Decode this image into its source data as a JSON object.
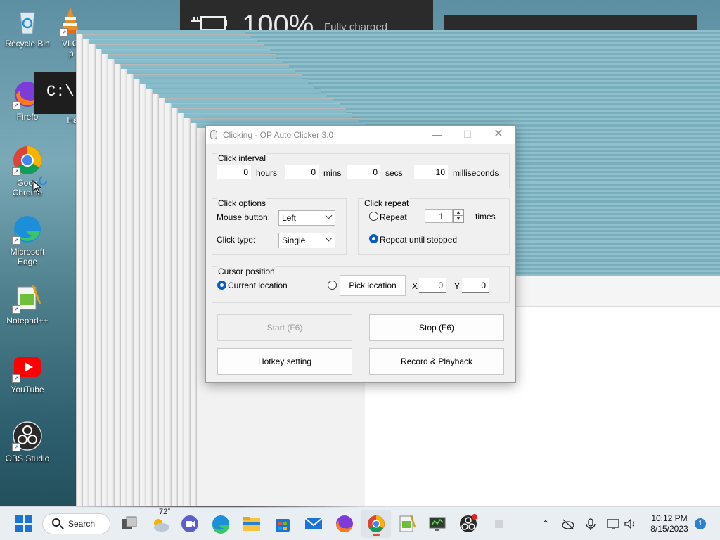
{
  "desktop": {
    "icons": [
      {
        "label": "Recycle Bin"
      },
      {
        "label": "VLC"
      },
      {
        "label": "p"
      },
      {
        "label": "Firefo"
      },
      {
        "label": "Ha"
      },
      {
        "label": "Goog Chrome"
      },
      {
        "label": "Microsoft Edge"
      },
      {
        "label": "Notepad++"
      },
      {
        "label": "YouTube"
      },
      {
        "label": "OBS Studio"
      }
    ]
  },
  "battery": {
    "percent": "100%",
    "status": "Fully charged"
  },
  "cmd": {
    "text": "C:\\"
  },
  "window": {
    "title": "Clicking - OP Auto Clicker 3.0",
    "interval": {
      "label": "Click interval",
      "hours_value": "0",
      "hours_label": "hours",
      "mins_value": "0",
      "mins_label": "mins",
      "secs_value": "0",
      "secs_label": "secs",
      "ms_value": "10",
      "ms_label": "milliseconds"
    },
    "options": {
      "label": "Click options",
      "mouse_button_label": "Mouse button:",
      "mouse_button_value": "Left",
      "click_type_label": "Click type:",
      "click_type_value": "Single"
    },
    "repeat": {
      "label": "Click repeat",
      "repeat_label": "Repeat",
      "repeat_count": "1",
      "times_label": "times",
      "until_stopped_label": "Repeat until stopped",
      "selected": "until_stopped"
    },
    "cursor": {
      "label": "Cursor position",
      "current_label": "Current location",
      "pick_label": "Pick location",
      "x_label": "X",
      "x_value": "0",
      "y_label": "Y",
      "y_value": "0",
      "selected": "current"
    },
    "buttons": {
      "start": "Start (F6)",
      "stop": "Stop (F6)",
      "hotkey": "Hotkey setting",
      "record": "Record & Playback"
    }
  },
  "taskbar": {
    "search_label": "Search",
    "weather": "72°",
    "time": "10:12 PM",
    "date": "8/15/2023",
    "notification_count": "1"
  },
  "colors": {
    "accent": "#0a5cc2",
    "teal": "#87bccb",
    "taskbar": "#e9eef3"
  }
}
